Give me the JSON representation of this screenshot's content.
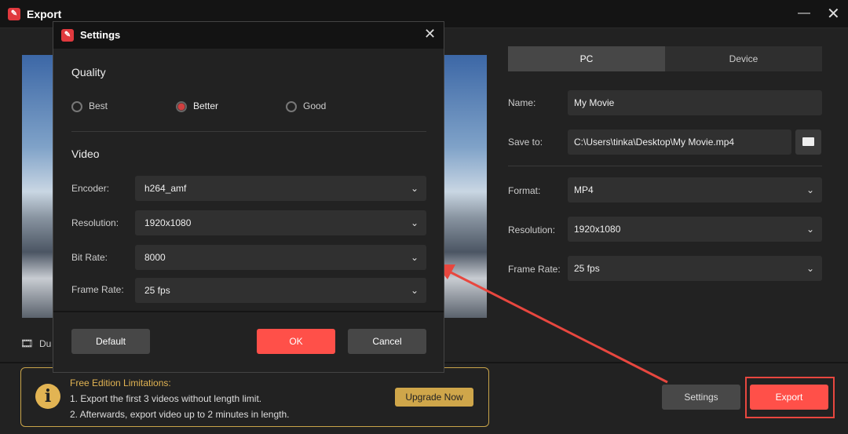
{
  "window": {
    "title": "Export",
    "minimize_icon": "minimize-icon",
    "close_icon": "close-icon"
  },
  "preview": {
    "duration_label": "Du"
  },
  "tabs": [
    {
      "label": "PC",
      "active": true
    },
    {
      "label": "Device",
      "active": false
    }
  ],
  "form": {
    "name_label": "Name:",
    "name_value": "My Movie",
    "save_label": "Save to:",
    "save_value": "C:\\Users\\tinka\\Desktop\\My Movie.mp4",
    "format_label": "Format:",
    "format_value": "MP4",
    "resolution_label": "Resolution:",
    "resolution_value": "1920x1080",
    "framerate_label": "Frame Rate:",
    "framerate_value": "25 fps"
  },
  "notice": {
    "title": "Free Edition Limitations:",
    "line1": "1. Export the first 3 videos without length limit.",
    "line2": "2. Afterwards, export video up to 2 minutes in length.",
    "upgrade": "Upgrade Now"
  },
  "buttons": {
    "settings": "Settings",
    "export": "Export"
  },
  "dialog": {
    "title": "Settings",
    "quality_heading": "Quality",
    "quality_options": [
      {
        "label": "Best",
        "selected": false
      },
      {
        "label": "Better",
        "selected": true
      },
      {
        "label": "Good",
        "selected": false
      }
    ],
    "video_heading": "Video",
    "encoder_label": "Encoder:",
    "encoder_value": "h264_amf",
    "resolution_label": "Resolution:",
    "resolution_value": "1920x1080",
    "bitrate_label": "Bit Rate:",
    "bitrate_value": "8000",
    "framerate_label": "Frame Rate:",
    "framerate_value": "25 fps",
    "default": "Default",
    "ok": "OK",
    "cancel": "Cancel"
  },
  "colors": {
    "accent": "#ff5049",
    "gold": "#c9a44a",
    "annotation": "#e8473f"
  }
}
